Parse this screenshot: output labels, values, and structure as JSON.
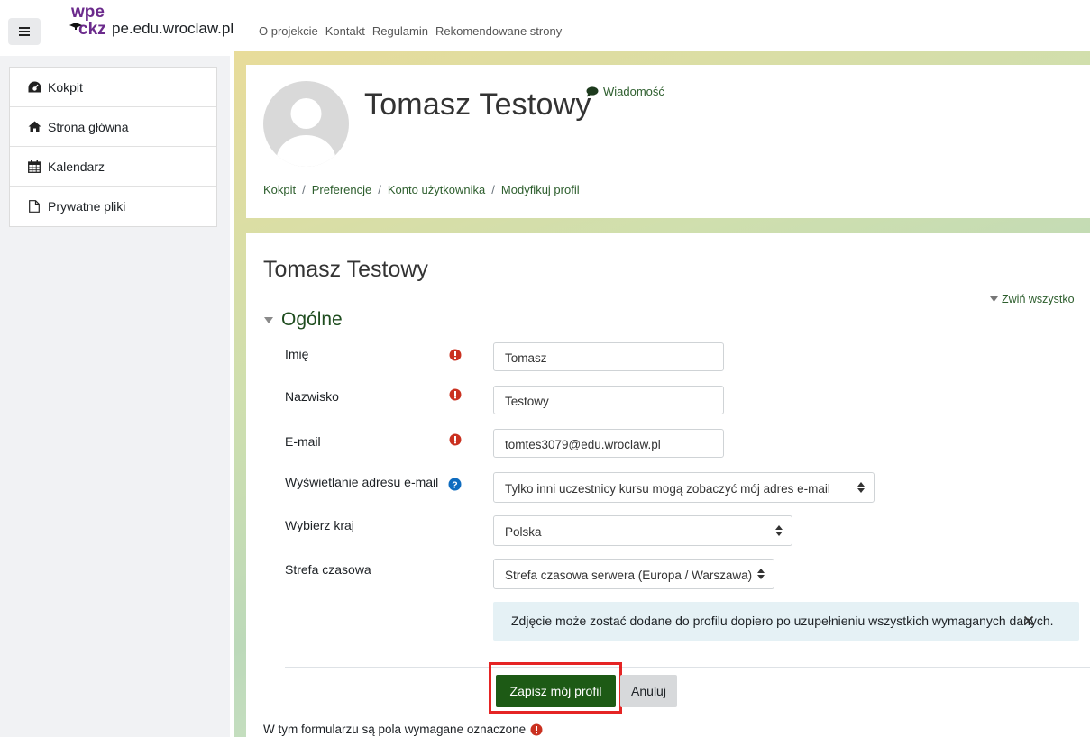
{
  "navbar": {
    "logo_text": "wpe ckz",
    "site_name": "pe.edu.wroclaw.pl",
    "links": [
      "O projekcie",
      "Kontakt",
      "Regulamin",
      "Rekomendowane strony"
    ]
  },
  "sidebar": {
    "items": [
      {
        "label": "Kokpit",
        "icon": "dashboard-icon"
      },
      {
        "label": "Strona główna",
        "icon": "home-icon"
      },
      {
        "label": "Kalendarz",
        "icon": "calendar-icon"
      },
      {
        "label": "Prywatne pliki",
        "icon": "file-icon"
      }
    ]
  },
  "header": {
    "full_name": "Tomasz Testowy",
    "message_link": "Wiadomość",
    "breadcrumb": [
      "Kokpit",
      "Preferencje",
      "Konto użytkownika",
      "Modyfikuj profil"
    ]
  },
  "form": {
    "title": "Tomasz Testowy",
    "collapse_all": "Zwiń wszystko",
    "section_title": "Ogólne",
    "fields": {
      "firstname": {
        "label": "Imię",
        "value": "Tomasz"
      },
      "lastname": {
        "label": "Nazwisko",
        "value": "Testowy"
      },
      "email": {
        "label": "E-mail",
        "value": "tomtes3079@edu.wroclaw.pl"
      },
      "email_display": {
        "label": "Wyświetlanie adresu e-mail",
        "value": "Tylko inni uczestnicy kursu mogą zobaczyć mój adres e-mail"
      },
      "country": {
        "label": "Wybierz kraj",
        "value": "Polska"
      },
      "timezone": {
        "label": "Strefa czasowa",
        "value": "Strefa czasowa serwera (Europa / Warszawa)"
      }
    },
    "notice": "Zdjęcie może zostać dodane do profilu dopiero po uzupełnieniu wszystkich wymaganych danych.",
    "save_label": "Zapisz mój profil",
    "cancel_label": "Anuluj",
    "required_note": "W tym formularzu są pola wymagane oznaczone"
  },
  "colors": {
    "accent_green": "#1d5a15",
    "link_green": "#2d5e2d",
    "required_red": "#ca3120",
    "highlight_red": "#e52424",
    "notice_bg": "#e5f1f5",
    "help_blue": "#0f6cbf"
  }
}
